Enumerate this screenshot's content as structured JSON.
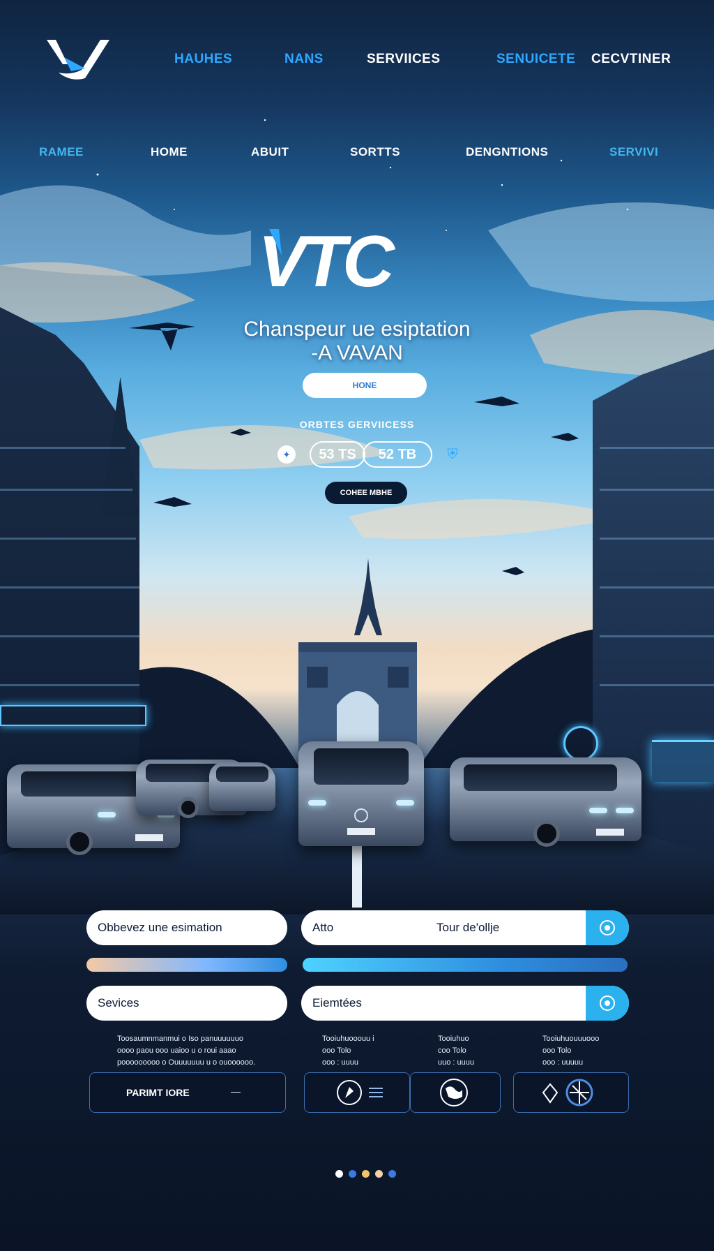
{
  "nav_top": {
    "items": [
      {
        "label": "HAUHES",
        "color": "#2ea8ff"
      },
      {
        "label": "NANS",
        "color": "#2ea8ff"
      },
      {
        "label": "SERVIICES",
        "color": "#ffffff"
      },
      {
        "label": "SENUICETE",
        "color": "#2ea8ff"
      },
      {
        "label": "CECVTINER",
        "color": "#ffffff"
      }
    ]
  },
  "nav_secondary": {
    "items": [
      {
        "label": "RAMEE",
        "color": "#43b8f0"
      },
      {
        "label": "HOME",
        "color": "#ffffff"
      },
      {
        "label": "ABUIT",
        "color": "#ffffff"
      },
      {
        "label": "SORTTS",
        "color": "#ffffff"
      },
      {
        "label": "DENGNTIONS",
        "color": "#ffffff"
      },
      {
        "label": "SERVIVI",
        "color": "#43b8f0"
      }
    ]
  },
  "hero": {
    "logo_text": "VTC",
    "title_line1": "Chanspeur ue esiptation",
    "title_line2": "-A VAVAN",
    "home_button": "HONE",
    "subtitle": "ORBTES GERVIICESS",
    "stats": [
      "53 TS",
      "52 TB"
    ],
    "cta_button": "COHEE MBHE"
  },
  "form": {
    "estimate_field": "Obbevez une esimation",
    "from_field": "Atto",
    "to_field": "Tour de'ollje",
    "services_field": "Sevices",
    "extras_field": "Eiemtées"
  },
  "info": {
    "left_lines": [
      "Toosaumnmanmui o Iso panuuuuuuo",
      "oooo paou ooo uaioo u o roui aaao",
      "pooooooooo o Ouuuuuuu u o ouoooooo."
    ],
    "col1": [
      "Tooiuhuooouu i",
      "ooo Tolo",
      "ooo : uuuu"
    ],
    "col2": [
      "Tooiuhuo",
      "coo Tolo",
      "uuo : uuuu"
    ],
    "col3": [
      "Tooiuhuouuuooo",
      "ooo Tolo",
      "ooo : uuuuu"
    ]
  },
  "actions": {
    "primary_button": "PARIMT IORE",
    "dash": "—"
  },
  "colors": {
    "accent": "#2bb1ee",
    "brand_blue": "#2ea8ff",
    "dark": "#0b1a33"
  },
  "pagination": {
    "dot_colors": [
      "#ffffff",
      "#3a7be0",
      "#f2c36a",
      "#f3d2a8",
      "#3a7be0"
    ]
  }
}
